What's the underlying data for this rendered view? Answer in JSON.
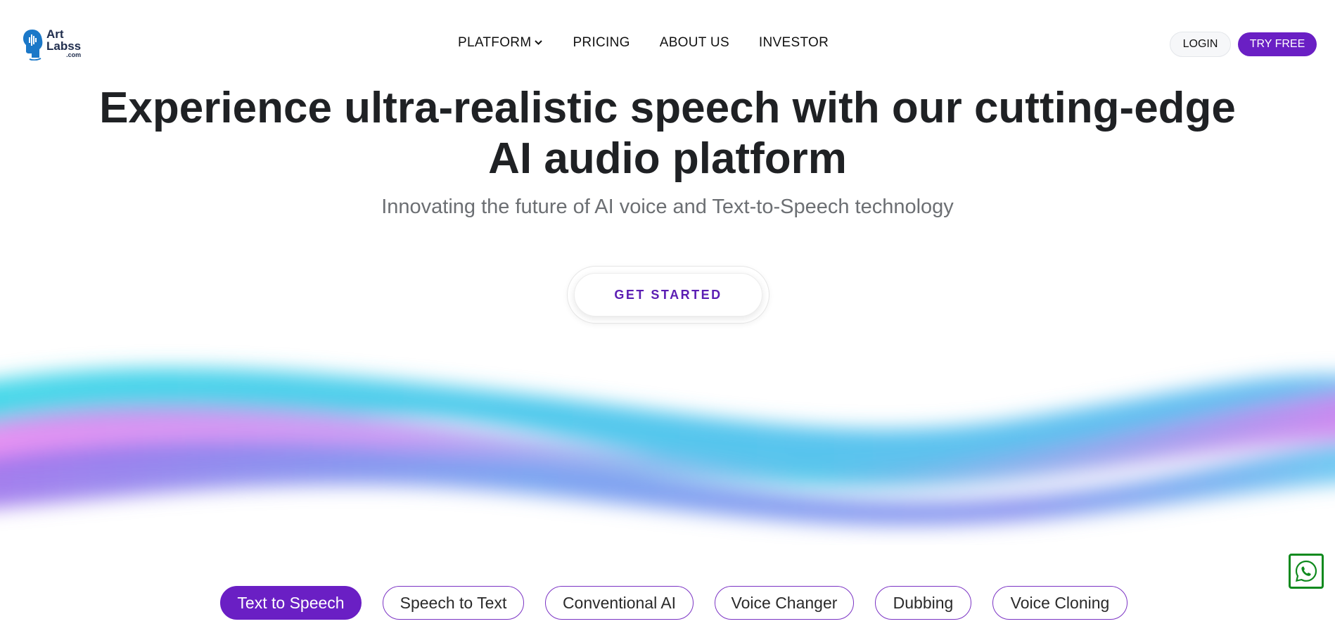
{
  "brand": {
    "line1": "Art",
    "line2": "Labss",
    "suffix": ".com"
  },
  "nav": {
    "items": [
      {
        "label": "PLATFORM",
        "has_dropdown": true
      },
      {
        "label": "PRICING"
      },
      {
        "label": "ABOUT US"
      },
      {
        "label": "INVESTOR"
      }
    ]
  },
  "header": {
    "login_label": "LOGIN",
    "try_label": "TRY FREE"
  },
  "hero": {
    "title_line1": "Experience ultra-realistic speech with our cutting-edge",
    "title_line2": "AI audio platform",
    "subtitle": "Innovating the future of AI voice and Text-to-Speech technology",
    "cta_label": "GET STARTED"
  },
  "tabs": [
    {
      "label": "Text to Speech",
      "active": true
    },
    {
      "label": "Speech to Text",
      "active": false
    },
    {
      "label": "Conventional AI",
      "active": false
    },
    {
      "label": "Voice Changer",
      "active": false
    },
    {
      "label": "Dubbing",
      "active": false
    },
    {
      "label": "Voice Cloning",
      "active": false
    }
  ],
  "icons": {
    "logo": "head-soundwave-icon",
    "dropdown": "chevron-down-icon",
    "chat": "whatsapp-icon"
  },
  "colors": {
    "accent": "#6a1fc4",
    "wave_cyan": "#3fd0e6",
    "wave_pink": "#e57ff0",
    "wave_blue": "#6f8ef0",
    "whatsapp_green": "#0f8a1e"
  }
}
